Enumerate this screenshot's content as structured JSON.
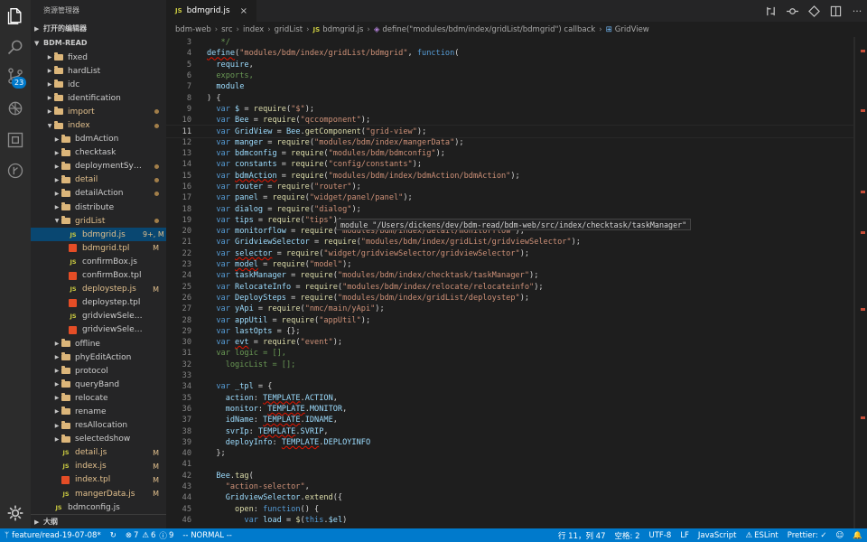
{
  "sidebar": {
    "title": "资源管理器",
    "open_editors": "打开的编辑器",
    "workspace": "BDM-READ",
    "outline": "大纲",
    "items": [
      {
        "label": "fixed",
        "type": "folder",
        "indent": 1,
        "status": ""
      },
      {
        "label": "hardList",
        "type": "folder",
        "indent": 1,
        "status": ""
      },
      {
        "label": "idc",
        "type": "folder",
        "indent": 1,
        "status": ""
      },
      {
        "label": "identification",
        "type": "folder",
        "indent": 1,
        "status": ""
      },
      {
        "label": "import",
        "type": "folder",
        "indent": 1,
        "status": "dot",
        "color": "mod"
      },
      {
        "label": "index",
        "type": "folder-open",
        "indent": 1,
        "status": "dot",
        "color": "mod"
      },
      {
        "label": "bdmAction",
        "type": "folder",
        "indent": 2,
        "status": ""
      },
      {
        "label": "checktask",
        "type": "folder",
        "indent": 2,
        "status": ""
      },
      {
        "label": "deploymentSyst...",
        "type": "folder",
        "indent": 2,
        "status": "dot"
      },
      {
        "label": "detail",
        "type": "folder",
        "indent": 2,
        "status": "dot",
        "color": "mod"
      },
      {
        "label": "detailAction",
        "type": "folder",
        "indent": 2,
        "status": "dot"
      },
      {
        "label": "distribute",
        "type": "folder",
        "indent": 2,
        "status": ""
      },
      {
        "label": "gridList",
        "type": "folder-open",
        "indent": 2,
        "status": "dot",
        "color": "mod"
      },
      {
        "label": "bdmgrid.js",
        "type": "js",
        "indent": 3,
        "status": "9+, M",
        "color": "mod",
        "selected": true
      },
      {
        "label": "bdmgrid.tpl",
        "type": "tpl",
        "indent": 3,
        "status": "M",
        "color": "mod"
      },
      {
        "label": "confirmBox.js",
        "type": "js",
        "indent": 3,
        "status": ""
      },
      {
        "label": "confirmBox.tpl",
        "type": "tpl",
        "indent": 3,
        "status": ""
      },
      {
        "label": "deploystep.js",
        "type": "js",
        "indent": 3,
        "status": "M",
        "color": "mod"
      },
      {
        "label": "deploystep.tpl",
        "type": "tpl",
        "indent": 3,
        "status": ""
      },
      {
        "label": "gridviewSelector.js",
        "type": "js",
        "indent": 3,
        "status": ""
      },
      {
        "label": "gridviewSelector.tpl",
        "type": "tpl",
        "indent": 3,
        "status": ""
      },
      {
        "label": "offline",
        "type": "folder",
        "indent": 2,
        "status": ""
      },
      {
        "label": "phyEditAction",
        "type": "folder",
        "indent": 2,
        "status": ""
      },
      {
        "label": "protocol",
        "type": "folder",
        "indent": 2,
        "status": ""
      },
      {
        "label": "queryBand",
        "type": "folder",
        "indent": 2,
        "status": ""
      },
      {
        "label": "relocate",
        "type": "folder",
        "indent": 2,
        "status": ""
      },
      {
        "label": "rename",
        "type": "folder",
        "indent": 2,
        "status": ""
      },
      {
        "label": "resAllocation",
        "type": "folder",
        "indent": 2,
        "status": ""
      },
      {
        "label": "selectedshow",
        "type": "folder",
        "indent": 2,
        "status": ""
      },
      {
        "label": "detail.js",
        "type": "js",
        "indent": 2,
        "status": "M",
        "color": "mod"
      },
      {
        "label": "index.js",
        "type": "js",
        "indent": 2,
        "status": "M",
        "color": "mod"
      },
      {
        "label": "index.tpl",
        "type": "tpl",
        "indent": 2,
        "status": "M",
        "color": "mod"
      },
      {
        "label": "mangerData.js",
        "type": "js",
        "indent": 2,
        "status": "M",
        "color": "mod"
      },
      {
        "label": "bdmconfig.js",
        "type": "js",
        "indent": 1,
        "status": ""
      }
    ]
  },
  "tab": {
    "icon": "JS",
    "label": "bdmgrid.js",
    "close": "×"
  },
  "breadcrumb": [
    "bdm-web",
    "src",
    "index",
    "gridList",
    "bdmgrid.js",
    "define(\"modules/bdm/index/gridList/bdmgrid\") callback",
    "GridView"
  ],
  "hover": "module \"/Users/dickens/dev/bdm-read/bdm-web/src/index/checktask/taskManager\"",
  "code": [
    {
      "n": "3",
      "t": [
        [
          "c",
          "   */"
        ]
      ]
    },
    {
      "n": "4",
      "t": [
        [
          "sq",
          "define"
        ],
        [
          "p",
          "("
        ],
        [
          "s",
          "\"modules/bdm/index/gridList/bdmgrid\""
        ],
        [
          "p",
          ", "
        ],
        [
          "k",
          "function"
        ],
        [
          "p",
          "("
        ]
      ]
    },
    {
      "n": "5",
      "t": [
        [
          "v",
          "  require"
        ],
        [
          "p",
          ","
        ]
      ]
    },
    {
      "n": "6",
      "t": [
        [
          "c",
          "  exports"
        ],
        [
          "c",
          ","
        ]
      ]
    },
    {
      "n": "7",
      "t": [
        [
          "v",
          "  module"
        ]
      ]
    },
    {
      "n": "8",
      "t": [
        [
          "p",
          ") {"
        ]
      ]
    },
    {
      "n": "9",
      "t": [
        [
          "k",
          "  var "
        ],
        [
          "v",
          "$"
        ],
        [
          "p",
          " = "
        ],
        [
          "f",
          "require"
        ],
        [
          "p",
          "("
        ],
        [
          "s",
          "\"$\""
        ],
        [
          "p",
          ");"
        ]
      ]
    },
    {
      "n": "10",
      "t": [
        [
          "k",
          "  var "
        ],
        [
          "v",
          "Bee"
        ],
        [
          "p",
          " = "
        ],
        [
          "f",
          "require"
        ],
        [
          "p",
          "("
        ],
        [
          "s",
          "\"qccomponent\""
        ],
        [
          "p",
          ");"
        ]
      ]
    },
    {
      "n": "11",
      "t": [
        [
          "k",
          "  var "
        ],
        [
          "v",
          "GridView"
        ],
        [
          "p",
          " = "
        ],
        [
          "v",
          "Bee"
        ],
        [
          "p",
          "."
        ],
        [
          "f",
          "getComponent"
        ],
        [
          "p",
          "("
        ],
        [
          "s",
          "\"grid-view\""
        ],
        [
          "p",
          ");"
        ]
      ],
      "cur": true
    },
    {
      "n": "12",
      "t": [
        [
          "k",
          "  var "
        ],
        [
          "v",
          "manger"
        ],
        [
          "p",
          " = "
        ],
        [
          "f",
          "require"
        ],
        [
          "p",
          "("
        ],
        [
          "s",
          "\"modules/bdm/index/mangerData\""
        ],
        [
          "p",
          ");"
        ]
      ]
    },
    {
      "n": "13",
      "t": [
        [
          "k",
          "  var "
        ],
        [
          "v",
          "bdmconfig"
        ],
        [
          "p",
          " = "
        ],
        [
          "f",
          "require"
        ],
        [
          "p",
          "("
        ],
        [
          "s",
          "\"modules/bdm/bdmconfig\""
        ],
        [
          "p",
          ");"
        ]
      ]
    },
    {
      "n": "14",
      "t": [
        [
          "k",
          "  var "
        ],
        [
          "v",
          "constants"
        ],
        [
          "p",
          " = "
        ],
        [
          "f",
          "require"
        ],
        [
          "p",
          "("
        ],
        [
          "s",
          "\"config/constants\""
        ],
        [
          "p",
          ");"
        ]
      ]
    },
    {
      "n": "15",
      "t": [
        [
          "k",
          "  var "
        ],
        [
          "sq",
          "bdmAction"
        ],
        [
          "p",
          " = "
        ],
        [
          "f",
          "require"
        ],
        [
          "p",
          "("
        ],
        [
          "s",
          "\"modules/bdm/index/bdmAction/bdmAction\""
        ],
        [
          "p",
          ");"
        ]
      ]
    },
    {
      "n": "16",
      "t": [
        [
          "k",
          "  var "
        ],
        [
          "v",
          "router"
        ],
        [
          "p",
          " = "
        ],
        [
          "f",
          "require"
        ],
        [
          "p",
          "("
        ],
        [
          "s",
          "\"router\""
        ],
        [
          "p",
          ");"
        ]
      ]
    },
    {
      "n": "17",
      "t": [
        [
          "k",
          "  var "
        ],
        [
          "v",
          "panel"
        ],
        [
          "p",
          " = "
        ],
        [
          "f",
          "require"
        ],
        [
          "p",
          "("
        ],
        [
          "s",
          "\"widget/panel/panel\""
        ],
        [
          "p",
          ");"
        ]
      ]
    },
    {
      "n": "18",
      "t": [
        [
          "k",
          "  var "
        ],
        [
          "v",
          "dialog"
        ],
        [
          "p",
          " = "
        ],
        [
          "f",
          "require"
        ],
        [
          "p",
          "("
        ],
        [
          "s",
          "\"dialog\""
        ],
        [
          "p",
          ");"
        ]
      ]
    },
    {
      "n": "19",
      "t": [
        [
          "k",
          "  var "
        ],
        [
          "v",
          "tips"
        ],
        [
          "p",
          " = "
        ],
        [
          "f",
          "require"
        ],
        [
          "p",
          "("
        ],
        [
          "s",
          "\"tips\""
        ],
        [
          "p",
          ");"
        ]
      ]
    },
    {
      "n": "20",
      "t": [
        [
          "k",
          "  var "
        ],
        [
          "v",
          "monitorflow"
        ],
        [
          "p",
          " = "
        ],
        [
          "f",
          "require"
        ],
        [
          "p",
          "("
        ],
        [
          "s",
          "\"modules/bdm/index/detail/monitorflow\""
        ],
        [
          "p",
          ");"
        ]
      ]
    },
    {
      "n": "21",
      "t": [
        [
          "k",
          "  var "
        ],
        [
          "v",
          "GridviewSelector"
        ],
        [
          "p",
          " = "
        ],
        [
          "f",
          "require"
        ],
        [
          "p",
          "("
        ],
        [
          "s",
          "\"modules/bdm/index/gridList/gridviewSelector\""
        ],
        [
          "p",
          ");"
        ]
      ]
    },
    {
      "n": "22",
      "t": [
        [
          "k",
          "  var "
        ],
        [
          "sq",
          "selector"
        ],
        [
          "p",
          " = "
        ],
        [
          "f",
          "require"
        ],
        [
          "p",
          "("
        ],
        [
          "s",
          "\"widget/gridviewSelector/gridviewSelector\""
        ],
        [
          "p",
          ");"
        ]
      ]
    },
    {
      "n": "23",
      "t": [
        [
          "k",
          "  var "
        ],
        [
          "sq",
          "model"
        ],
        [
          "p",
          " = "
        ],
        [
          "f",
          "require"
        ],
        [
          "p",
          "("
        ],
        [
          "s",
          "\"model\""
        ],
        [
          "p",
          ");"
        ]
      ]
    },
    {
      "n": "24",
      "t": [
        [
          "k",
          "  var "
        ],
        [
          "v",
          "taskManager"
        ],
        [
          "p",
          " = "
        ],
        [
          "f",
          "require"
        ],
        [
          "p",
          "("
        ],
        [
          "s",
          "\"modules/bdm/index/checktask/taskManager\""
        ],
        [
          "p",
          ");"
        ]
      ]
    },
    {
      "n": "25",
      "t": [
        [
          "k",
          "  var "
        ],
        [
          "v",
          "RelocateInfo"
        ],
        [
          "p",
          " = "
        ],
        [
          "f",
          "require"
        ],
        [
          "p",
          "("
        ],
        [
          "s",
          "\"modules/bdm/index/relocate/relocateinfo\""
        ],
        [
          "p",
          ");"
        ]
      ]
    },
    {
      "n": "26",
      "t": [
        [
          "k",
          "  var "
        ],
        [
          "v",
          "DeploySteps"
        ],
        [
          "p",
          " = "
        ],
        [
          "f",
          "require"
        ],
        [
          "p",
          "("
        ],
        [
          "s",
          "\"modules/bdm/index/gridList/deploystep\""
        ],
        [
          "p",
          ");"
        ]
      ]
    },
    {
      "n": "27",
      "t": [
        [
          "k",
          "  var "
        ],
        [
          "v",
          "yApi"
        ],
        [
          "p",
          " = "
        ],
        [
          "f",
          "require"
        ],
        [
          "p",
          "("
        ],
        [
          "s",
          "\"nmc/main/yApi\""
        ],
        [
          "p",
          ");"
        ]
      ]
    },
    {
      "n": "28",
      "t": [
        [
          "k",
          "  var "
        ],
        [
          "v",
          "appUtil"
        ],
        [
          "p",
          " = "
        ],
        [
          "f",
          "require"
        ],
        [
          "p",
          "("
        ],
        [
          "s",
          "\"appUtil\""
        ],
        [
          "p",
          ");"
        ]
      ]
    },
    {
      "n": "29",
      "t": [
        [
          "k",
          "  var "
        ],
        [
          "v",
          "lastOpts"
        ],
        [
          "p",
          " = {};"
        ]
      ]
    },
    {
      "n": "30",
      "t": [
        [
          "k",
          "  var "
        ],
        [
          "sq",
          "evt"
        ],
        [
          "p",
          " = "
        ],
        [
          "f",
          "require"
        ],
        [
          "p",
          "("
        ],
        [
          "s",
          "\"event\""
        ],
        [
          "p",
          ");"
        ]
      ]
    },
    {
      "n": "31",
      "t": [
        [
          "c",
          "  var "
        ],
        [
          "c",
          "logic"
        ],
        [
          "c",
          " = [],"
        ]
      ]
    },
    {
      "n": "32",
      "t": [
        [
          "c",
          "    logicList"
        ],
        [
          "c",
          " = [];"
        ]
      ]
    },
    {
      "n": "33",
      "t": [
        [
          "p",
          ""
        ]
      ]
    },
    {
      "n": "34",
      "t": [
        [
          "k",
          "  var "
        ],
        [
          "v",
          "_tpl"
        ],
        [
          "p",
          " = {"
        ]
      ]
    },
    {
      "n": "35",
      "t": [
        [
          "v",
          "    action"
        ],
        [
          "p",
          ": "
        ],
        [
          "sq",
          "TEMPLATE"
        ],
        [
          "p",
          "."
        ],
        [
          "v",
          "ACTION"
        ],
        [
          "p",
          ","
        ]
      ]
    },
    {
      "n": "36",
      "t": [
        [
          "v",
          "    monitor"
        ],
        [
          "p",
          ": "
        ],
        [
          "sq",
          "TEMPLATE"
        ],
        [
          "p",
          "."
        ],
        [
          "v",
          "MONITOR"
        ],
        [
          "p",
          ","
        ]
      ]
    },
    {
      "n": "37",
      "t": [
        [
          "v",
          "    idName"
        ],
        [
          "p",
          ": "
        ],
        [
          "sq",
          "TEMPLATE"
        ],
        [
          "p",
          "."
        ],
        [
          "v",
          "IDNAME"
        ],
        [
          "p",
          ","
        ]
      ]
    },
    {
      "n": "38",
      "t": [
        [
          "v",
          "    svrIp"
        ],
        [
          "p",
          ": "
        ],
        [
          "sq",
          "TEMPLATE"
        ],
        [
          "p",
          "."
        ],
        [
          "v",
          "SVRIP"
        ],
        [
          "p",
          ","
        ]
      ]
    },
    {
      "n": "39",
      "t": [
        [
          "v",
          "    deployInfo"
        ],
        [
          "p",
          ": "
        ],
        [
          "sq",
          "TEMPLATE"
        ],
        [
          "p",
          "."
        ],
        [
          "v",
          "DEPLOYINFO"
        ]
      ]
    },
    {
      "n": "40",
      "t": [
        [
          "p",
          "  };"
        ]
      ]
    },
    {
      "n": "41",
      "t": [
        [
          "p",
          ""
        ]
      ]
    },
    {
      "n": "42",
      "t": [
        [
          "v",
          "  Bee"
        ],
        [
          "p",
          "."
        ],
        [
          "f",
          "tag"
        ],
        [
          "p",
          "("
        ]
      ]
    },
    {
      "n": "43",
      "t": [
        [
          "s",
          "    \"action-selector\""
        ],
        [
          "p",
          ","
        ]
      ]
    },
    {
      "n": "44",
      "t": [
        [
          "v",
          "    GridviewSelector"
        ],
        [
          "p",
          "."
        ],
        [
          "f",
          "extend"
        ],
        [
          "p",
          "({"
        ]
      ]
    },
    {
      "n": "45",
      "t": [
        [
          "f",
          "      open"
        ],
        [
          "p",
          ": "
        ],
        [
          "k",
          "function"
        ],
        [
          "p",
          "() {"
        ]
      ]
    },
    {
      "n": "46",
      "t": [
        [
          "k",
          "        var "
        ],
        [
          "v",
          "load"
        ],
        [
          "p",
          " = "
        ],
        [
          "f",
          "$"
        ],
        [
          "p",
          "("
        ],
        [
          "k",
          "this"
        ],
        [
          "p",
          "."
        ],
        [
          "v",
          "$el"
        ],
        [
          "p",
          ")"
        ]
      ]
    }
  ],
  "status": {
    "branch": "feature/read-19-07-08*",
    "sync": "↻",
    "errors": "7",
    "warnings": "6",
    "info": "9",
    "mode": "-- NORMAL --",
    "position": "行 11，列 47",
    "spaces": "空格: 2",
    "encoding": "UTF-8",
    "eol": "LF",
    "language": "JavaScript",
    "eslint": "ESLint",
    "prettier": "Prettier: ✓",
    "scm_badge": "23"
  }
}
